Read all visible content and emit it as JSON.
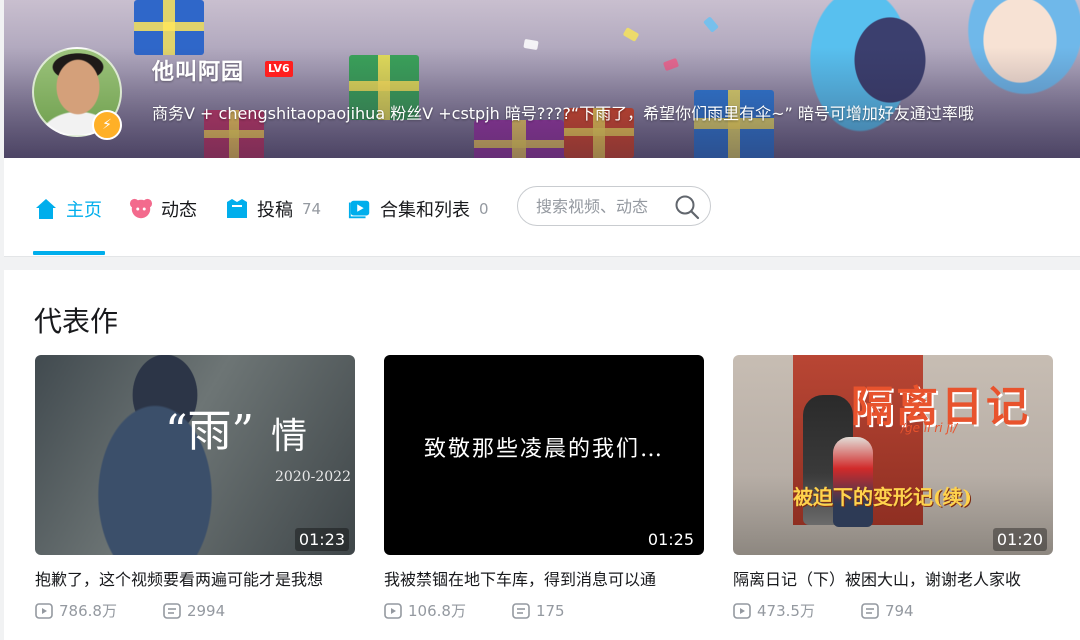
{
  "profile": {
    "username": "他叫阿园",
    "level": "LV6",
    "signature": "商务V + chengshitaopaojihua 粉丝V +cstpjh 暗号????“下雨了，希望你们雨里有伞~”  暗号可增加好友通过率哦",
    "avatar_badge_icon": "lightning-icon"
  },
  "nav": {
    "items": [
      {
        "label": "主页",
        "count": "",
        "icon": "home-icon",
        "active": true
      },
      {
        "label": "动态",
        "count": "",
        "icon": "dynamic-icon"
      },
      {
        "label": "投稿",
        "count": "74",
        "icon": "upload-icon"
      },
      {
        "label": "合集和列表",
        "count": "0",
        "icon": "collection-icon"
      }
    ],
    "search": {
      "placeholder": "搜索视频、动态",
      "icon": "search-icon"
    }
  },
  "colors": {
    "accent": "#00aeec",
    "level_badge": "#ff1f1f",
    "avatar_badge": "#ffb027"
  },
  "section": {
    "title": "代表作"
  },
  "videos": [
    {
      "title": "抱歉了，这个视频要看两遍可能才是我想",
      "duration": "01:23",
      "views": "786.8万",
      "comments": "2994",
      "thumb_text": [
        "“雨”",
        "情",
        "2020-2022"
      ]
    },
    {
      "title": "我被禁锢在地下车库，得到消息可以通",
      "duration": "01:25",
      "views": "106.8万",
      "comments": "175",
      "thumb_text": [
        "致敬那些凌晨的我们…"
      ]
    },
    {
      "title": "隔离日记（下）被困大山，谢谢老人家收",
      "duration": "01:20",
      "views": "473.5万",
      "comments": "794",
      "thumb_text": [
        "隔离日记",
        "/ge li ri ji/",
        "被迫下的变形记(续)"
      ]
    }
  ]
}
